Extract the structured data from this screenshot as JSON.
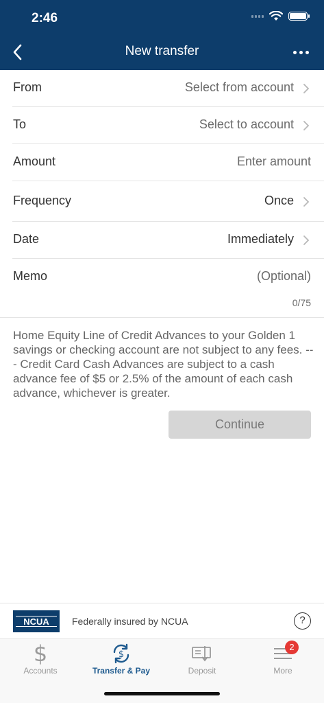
{
  "status_bar": {
    "time": "2:46"
  },
  "nav": {
    "title": "New transfer",
    "back_icon": "chevron-left-icon",
    "more_icon": "more-horizontal-icon"
  },
  "form": {
    "from": {
      "label": "From",
      "value": "Select from account"
    },
    "to": {
      "label": "To",
      "value": "Select to account"
    },
    "amount": {
      "label": "Amount",
      "placeholder": "Enter amount"
    },
    "frequency": {
      "label": "Frequency",
      "value": "Once"
    },
    "date": {
      "label": "Date",
      "value": "Immediately"
    },
    "memo": {
      "label": "Memo",
      "placeholder": "(Optional)",
      "counter": "0/75"
    }
  },
  "disclosure": "Home Equity Line of Credit Advances to your Golden 1 savings or checking account are not subject to any fees.  ---  Credit Card Cash Advances are subject to a cash advance fee of $5 or 2.5% of the amount of each cash advance, whichever is greater.",
  "continue_label": "Continue",
  "footer": {
    "ncua_logo_text": "NCUA",
    "insured_text": "Federally insured by NCUA",
    "help_symbol": "?"
  },
  "tabs": [
    {
      "label": "Accounts",
      "icon": "dollar-icon"
    },
    {
      "label": "Transfer & Pay",
      "icon": "transfer-pay-icon",
      "active": true
    },
    {
      "label": "Deposit",
      "icon": "check-deposit-icon"
    },
    {
      "label": "More",
      "icon": "menu-icon",
      "badge": "2"
    }
  ],
  "colors": {
    "header": "#0d3d6b",
    "active_tab": "#1f5b8f",
    "badge": "#e53935",
    "button_disabled": "#d6d6d6"
  }
}
